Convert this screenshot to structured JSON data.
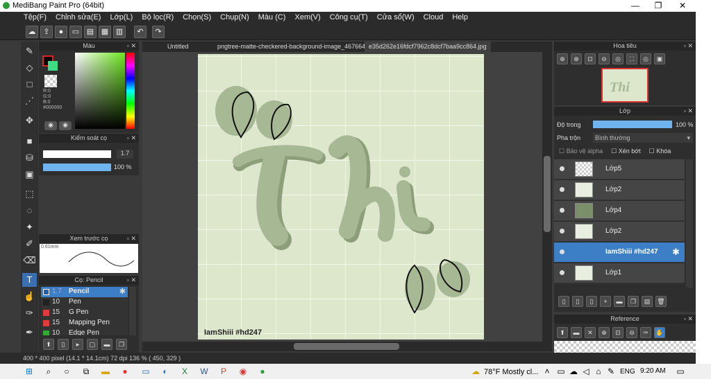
{
  "app": {
    "title": "MediBang Paint Pro (64bit)"
  },
  "menu": [
    "Tệp(F)",
    "Chỉnh sửa(E)",
    "Lớp(L)",
    "Bộ lọc(R)",
    "Chọn(S)",
    "Chụp(N)",
    "Màu (C)",
    "Xem(V)",
    "Công cụ(T)",
    "Cửa sổ(W)",
    "Cloud",
    "Help"
  ],
  "color_panel": {
    "title": "Màu",
    "r": "R:0",
    "g": "G:0",
    "b": "B:0",
    "hex": "#000000"
  },
  "brush_control": {
    "title": "Kiểm soát cọ",
    "size": "1.7",
    "opacity": "100 %"
  },
  "brush_preview": {
    "title": "Xem trước cọ",
    "size": "0.61mm"
  },
  "brush_list": {
    "title": "Cọ: Pencil",
    "items": [
      {
        "size": "1.7",
        "name": "Pencil",
        "color": "#2a5fa8"
      },
      {
        "size": "10",
        "name": "Pen",
        "color": "#222222"
      },
      {
        "size": "15",
        "name": "G Pen",
        "color": "#e03a3a"
      },
      {
        "size": "15",
        "name": "Mapping Pen",
        "color": "#e03a3a"
      },
      {
        "size": "10",
        "name": "Edge Pen",
        "color": "#33aa33"
      }
    ]
  },
  "tabs": [
    "Untitled",
    "pngtree-matte-checkered-background-image_467664.jpg",
    "e35d262e16fdcf7962c8dcf7baa9cc864.jpg"
  ],
  "canvas": {
    "watermark": "IamShiii  #hd247",
    "title_text": "Thi",
    "bg": "#dde7cc",
    "grid": "#ffffff",
    "letter": "#a7b895",
    "letter_dark": "#8c9f7a"
  },
  "navigator": {
    "title": "Hoa tiêu"
  },
  "layers": {
    "title": "Lớp",
    "opacity_label": "Độ trong",
    "opacity": "100 %",
    "blend_label": "Pha trộn",
    "blend": "Bình thường",
    "alpha_label": "Bảo vệ alpha",
    "clip_label": "Xén bớt",
    "lock_label": "Khóa",
    "items": [
      {
        "name": "Lớp5"
      },
      {
        "name": "Lớp2"
      },
      {
        "name": "Lớp4"
      },
      {
        "name": "Lớp2"
      },
      {
        "name": "IamShiii  #hd247"
      },
      {
        "name": "Lớp1"
      }
    ]
  },
  "reference": {
    "title": "Reference"
  },
  "status": "400 * 400 pixel  (14.1 * 14.1cm)  72 dpi  136 %  ( 450, 329 )",
  "taskbar": {
    "weather": "78°F  Mostly cl...",
    "lang": "ENG",
    "time": "9:20 AM"
  }
}
